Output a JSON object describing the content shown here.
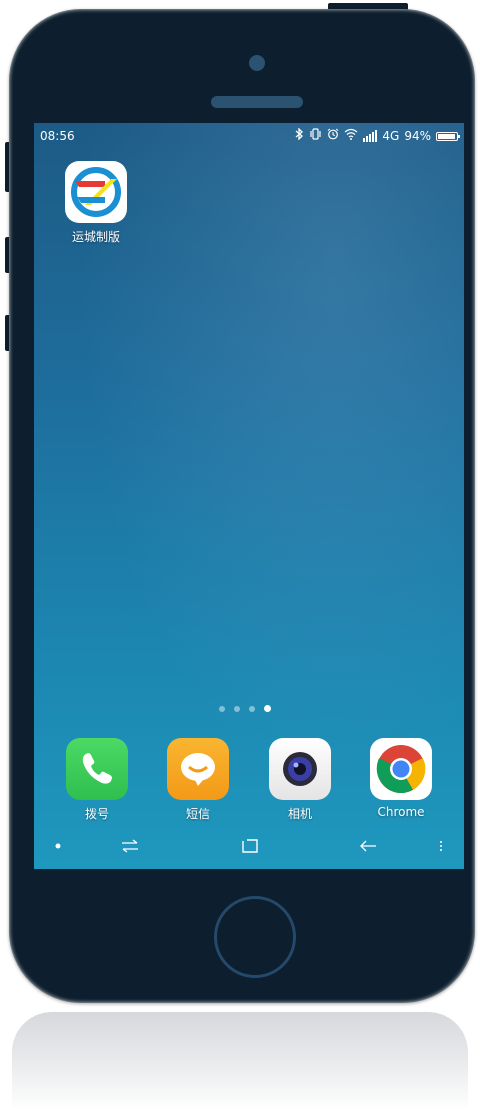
{
  "statusbar": {
    "time": "08:56",
    "network": "4G",
    "battery": "94%",
    "battery_level": 0.94,
    "icons": [
      "bluetooth-icon",
      "vibrate-icon",
      "alarm-icon",
      "wifi-icon",
      "signal-icon",
      "battery-icon"
    ]
  },
  "home": {
    "apps": [
      {
        "label": "运城制版",
        "icon": "yuncheng-zhiban-app-icon"
      }
    ],
    "page_count": 4,
    "active_page": 4
  },
  "dock": {
    "apps": [
      {
        "label": "拨号",
        "icon": "phone-icon",
        "color": "#34c759"
      },
      {
        "label": "短信",
        "icon": "message-icon",
        "color": "#f5a623"
      },
      {
        "label": "相机",
        "icon": "camera-icon",
        "color": "#f1f1f1"
      },
      {
        "label": "Chrome",
        "icon": "chrome-icon",
        "color": "#ffffff"
      }
    ]
  },
  "navbar": {
    "items": [
      "dot-icon",
      "switch-icon",
      "home-square-icon",
      "back-icon",
      "menu-icon"
    ]
  },
  "colors": {
    "phone_body": "#0d1f2e",
    "wallpaper_top": "#1d5b86",
    "wallpaper_bottom": "#1f98be"
  }
}
